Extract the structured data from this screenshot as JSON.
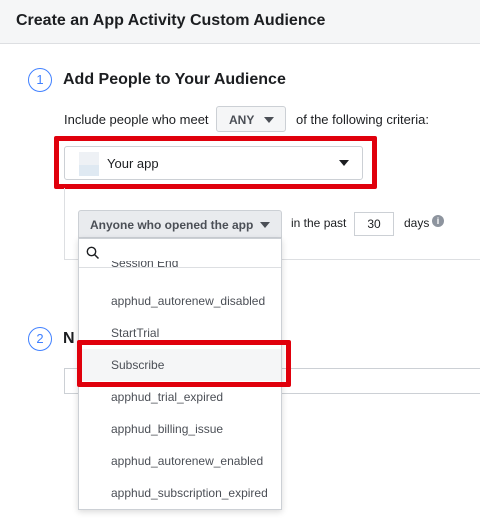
{
  "header": {
    "title": "Create an App Activity Custom Audience"
  },
  "step1": {
    "number": "1",
    "title": "Add People to Your Audience",
    "include_prefix": "Include people who meet",
    "match_value": "ANY",
    "include_suffix": "of the following criteria:",
    "app_select_value": "Your app"
  },
  "criteria": {
    "event_value": "Anyone who opened the app",
    "in_the_past_label": "in the past",
    "days_value": "30",
    "days_label": "days",
    "info_glyph": "i"
  },
  "dropdown": {
    "search_placeholder": "",
    "partial_item": "Session End",
    "items": [
      "apphud_autorenew_disabled",
      "StartTrial",
      "Subscribe",
      "apphud_trial_expired",
      "apphud_billing_issue",
      "apphud_autorenew_enabled",
      "apphud_subscription_expired"
    ],
    "highlighted_item": "Subscribe"
  },
  "step2": {
    "number": "2",
    "title_partial": "N"
  },
  "colors": {
    "accent": "#4080ff",
    "annotation_red": "#e0000c",
    "header_bg": "#f5f6f7"
  }
}
